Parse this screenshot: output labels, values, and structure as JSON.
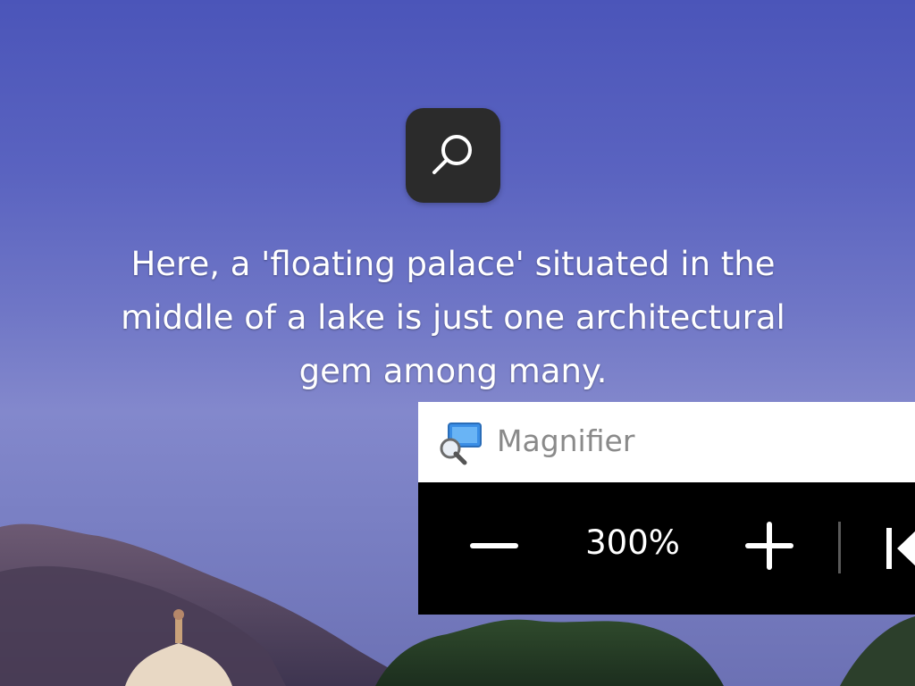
{
  "desktop": {
    "spotlight_caption": "Here, a 'floating palace' situated in the middle of a lake is just one architectural gem among many.",
    "spotlight_icon": "search-icon"
  },
  "magnifier": {
    "title": "Magnifier",
    "app_icon": "magnifier-app-icon",
    "zoom_out_icon": "minus-icon",
    "zoom_level": "300%",
    "zoom_in_icon": "plus-icon",
    "views_icon": "views-icon"
  },
  "colors": {
    "sky_top": "#4b55b9",
    "search_tile": "#2b2b2b",
    "toolbar_bg": "#000000",
    "titlebar_bg": "#ffffff",
    "accent_blue": "#3a8ee6"
  }
}
